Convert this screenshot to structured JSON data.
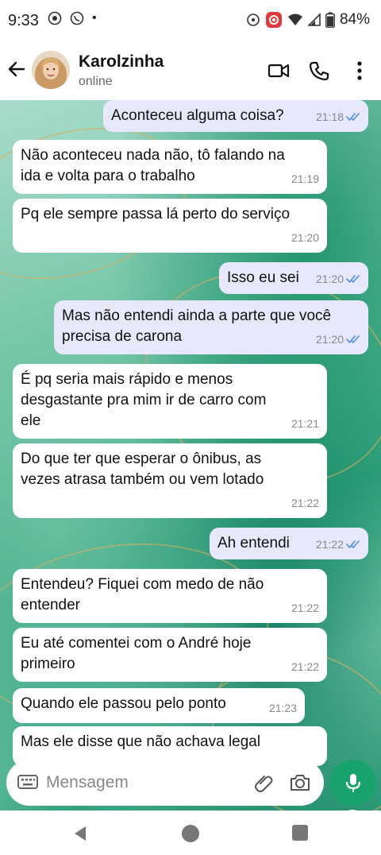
{
  "status_bar": {
    "time": "9:33",
    "battery": "84%",
    "dot": "•"
  },
  "header": {
    "contact_name": "Karolzinha",
    "contact_status": "online",
    "icons": [
      "back-arrow-icon",
      "video-call-icon",
      "phone-icon",
      "more-options-icon"
    ]
  },
  "messages": [
    {
      "dir": "out",
      "lines": [
        "Aconteceu alguma coisa?"
      ],
      "time": "21:18",
      "read": true
    },
    {
      "dir": "in",
      "lines": [
        "Não aconteceu nada não, tô falando na",
        "ida e volta para o trabalho"
      ],
      "time": "21:19"
    },
    {
      "dir": "in",
      "lines": [
        "Pq ele sempre passa lá perto do serviço"
      ],
      "time": "21:20"
    },
    {
      "dir": "out",
      "lines": [
        "Isso eu sei"
      ],
      "time": "21:20",
      "read": true
    },
    {
      "dir": "out",
      "lines": [
        "Mas não entendi ainda a parte que você",
        "precisa de carona"
      ],
      "time": "21:20",
      "read": true
    },
    {
      "dir": "in",
      "lines": [
        "É pq seria mais rápido e menos",
        "desgastante pra mim ir de carro com",
        "ele"
      ],
      "time": "21:21"
    },
    {
      "dir": "in",
      "lines": [
        "Do que ter que esperar o ônibus, as",
        "vezes atrasa também ou vem lotado"
      ],
      "time": "21:22"
    },
    {
      "dir": "out",
      "lines": [
        "Ah entendi"
      ],
      "time": "21:22",
      "read": true
    },
    {
      "dir": "in",
      "lines": [
        "Entendeu? Fiquei com medo de não",
        "entender"
      ],
      "time": "21:22"
    },
    {
      "dir": "in",
      "lines": [
        "Eu até comentei com o André hoje",
        "primeiro"
      ],
      "time": "21:22"
    },
    {
      "dir": "in",
      "lines": [
        "Quando ele passou pelo ponto"
      ],
      "time": "21:23"
    },
    {
      "dir": "in",
      "lines": [
        "Mas ele disse que não achava legal"
      ],
      "time": ""
    }
  ],
  "composer": {
    "placeholder": "Mensagem"
  },
  "colors": {
    "accent": "#18a36c",
    "read_ticks": "#4f8fe0",
    "outgoing_bubble": "#e7e8fc",
    "incoming_bubble": "#ffffff"
  }
}
